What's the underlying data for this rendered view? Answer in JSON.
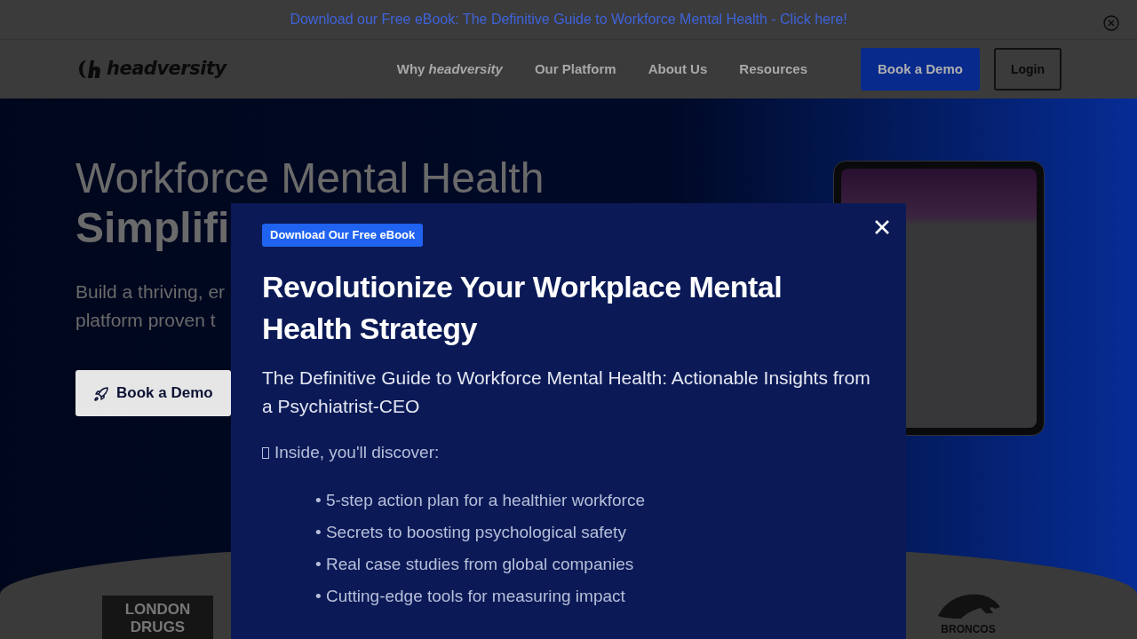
{
  "banner": {
    "text": "Download our Free eBook: The Definitive Guide to Workforce Mental Health - Click here!"
  },
  "navbar": {
    "logo": "headversity",
    "links": [
      {
        "label": "Why *headversity*"
      },
      {
        "label": "Our Platform"
      },
      {
        "label": "About Us"
      },
      {
        "label": "Resources"
      }
    ],
    "buttons": [
      {
        "label": "Book a Demo",
        "kind": "primary"
      },
      {
        "label": "Login",
        "kind": "outline"
      }
    ]
  },
  "hero": {
    "heading": [
      "Workforce Mental Health",
      "Simplifi"
    ],
    "subtitle": [
      "Build a thriving, er",
      "platform proven t"
    ],
    "cta": "Book a Demo"
  },
  "logos": [
    "LONDON DRUGS",
    "BRONCOS"
  ],
  "modal": {
    "badge": "Download Our Free eBook",
    "title": "Revolutionize Your Workplace Mental Health Strategy",
    "subtitle": "The Definitive Guide to Workforce Mental Health: Actionable Insights from a Psychiatrist-CEO",
    "intro": "Inside, you'll discover:",
    "bullets": [
      "• 5-step action plan for a healthier workforce",
      "• Secrets to boosting psychological safety",
      "• Real case studies from global companies",
      "• Cutting-edge tools for measuring impact"
    ]
  }
}
